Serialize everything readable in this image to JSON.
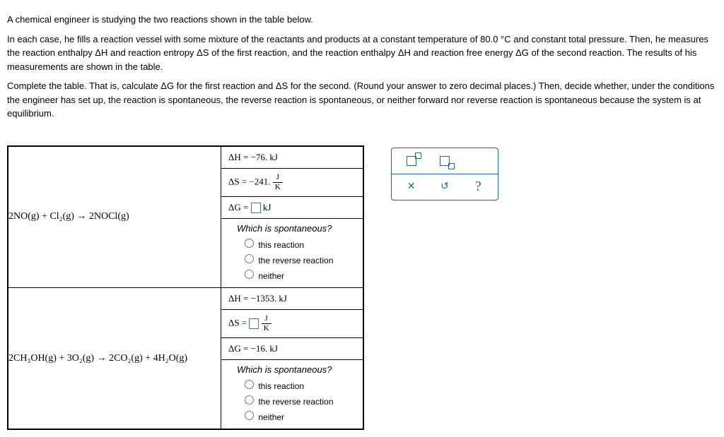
{
  "problem": {
    "p1": "A chemical engineer is studying the two reactions shown in the table below.",
    "p2": "In each case, he fills a reaction vessel with some mixture of the reactants and products at a constant temperature of 80.0 °C and constant total pressure. Then, he measures the reaction enthalpy ΔH and reaction entropy ΔS of the first reaction, and the reaction enthalpy ΔH and reaction free energy ΔG of the second reaction. The results of his measurements are shown in the table.",
    "p3": "Complete the table. That is, calculate ΔG for the first reaction and ΔS for the second. (Round your answer to zero decimal places.) Then, decide whether, under the conditions the engineer has set up, the reaction is spontaneous, the reverse reaction is spontaneous, or neither forward nor reverse reaction is spontaneous because the system is at equilibrium."
  },
  "reactions": {
    "r1": {
      "equation": "2NO(g) + Cl₂(g)  →  2NOCl(g)",
      "dH": "ΔH  =  −76. kJ",
      "dS_prefix": "ΔS  =  −241. ",
      "dG_prefix": "ΔG  =  ",
      "dG_suffix": " kJ"
    },
    "r2": {
      "equation": "2CH₃OH(g) + 3O₂(g)  →  2CO₂(g) + 4H₂O(g)",
      "dH": "ΔH  =  −1353. kJ",
      "dS_prefix": "ΔS  =  ",
      "dG": "ΔG  =  −16. kJ"
    }
  },
  "frac": {
    "j": "J",
    "k": "K"
  },
  "spont": {
    "title": "Which is spontaneous?",
    "opt1": "this reaction",
    "opt2": "the reverse reaction",
    "opt3": "neither"
  },
  "toolbox": {
    "x": "✕",
    "reset": "↺",
    "help": "?"
  }
}
